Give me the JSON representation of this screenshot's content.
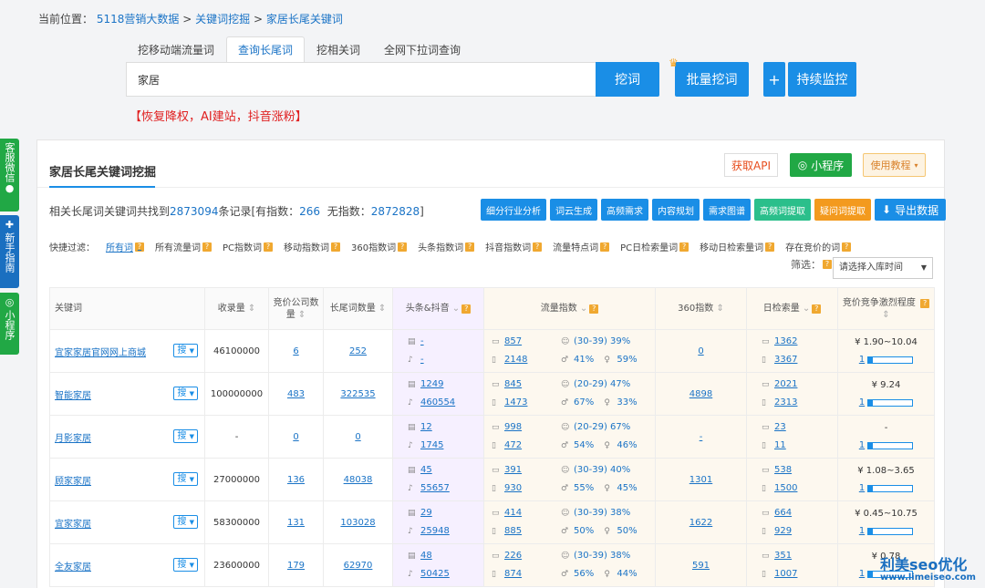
{
  "breadcrumb": {
    "prefix": "当前位置：",
    "items": [
      "5118营销大数据",
      "关键词挖掘",
      "家居长尾关键词"
    ],
    "sep": ">"
  },
  "tabs": [
    "挖移动端流量词",
    "查询长尾词",
    "挖相关词",
    "全网下拉词查询"
  ],
  "search": {
    "value": "家居"
  },
  "buttons": {
    "dig": "挖词",
    "batch": "批量挖词",
    "plus": "+",
    "monitor": "持续监控"
  },
  "promo": "【恢复降权，AI建站，抖音涨粉】",
  "sidebar": [
    {
      "label": "客服微信",
      "icon": "wechat-icon"
    },
    {
      "label": "新手指南",
      "icon": "guide-icon"
    },
    {
      "label": "小程序",
      "icon": "mini-program-icon"
    }
  ],
  "panel": {
    "title": "家居长尾关键词挖掘",
    "api": "获取API",
    "mini": "小程序",
    "tutorial": "使用教程"
  },
  "summary": {
    "prefix": "相关长尾词关键词共找到",
    "total": "2873094",
    "mid": "条记录[有指数：",
    "with_index": "266",
    "mid2": "  无指数：",
    "no_index": "2872828",
    "suffix": "]"
  },
  "tool_buttons": [
    "细分行业分析",
    "词云生成",
    "高频需求",
    "内容规划",
    "需求图谱",
    "高频词提取",
    "疑问词提取",
    "导出数据"
  ],
  "filters": {
    "prefix": "快捷过滤：",
    "items": [
      "所有词",
      "所有流量词",
      "PC指数词",
      "移动指数词",
      "360指数词",
      "头条指数词",
      "抖音指数词",
      "流量特点词",
      "PC日检索量词",
      "移动日检索量词",
      "存在竞价的词"
    ]
  },
  "filter_select": {
    "label": "筛选：",
    "placeholder": "请选择入库时间"
  },
  "table": {
    "headers": {
      "keyword": "关键词",
      "records": "收录量",
      "bid_companies": "竞价公司数量",
      "longtail": "长尾词数量",
      "toutiao": "头条&抖音",
      "flow": "流量指数",
      "idx360": "360指数",
      "daily": "日检索量",
      "competition": "竞价竞争激烈程度"
    },
    "search_btn": "搜",
    "rows": [
      {
        "kw_pre": "宜家",
        "kw_hl": "家居",
        "kw_post": "官网网上商城",
        "records": "46100000",
        "bid": "6",
        "longtail": "252",
        "tt1": "-",
        "tt2": "-",
        "pc": "857",
        "mobile": "2148",
        "age": "(30-39) 39%",
        "female": "41%",
        "male": "59%",
        "i360": "0",
        "d_pc": "1362",
        "d_mob": "3367",
        "price": "¥ 1.90~10.04",
        "level": "1",
        "fill": 0.1
      },
      {
        "kw_pre": "智能",
        "kw_hl": "家居",
        "kw_post": "",
        "records": "100000000",
        "bid": "483",
        "longtail": "322535",
        "tt1": "1249",
        "tt2": "460554",
        "pc": "845",
        "mobile": "1473",
        "age": "(20-29) 47%",
        "female": "67%",
        "male": "33%",
        "i360": "4898",
        "d_pc": "2021",
        "d_mob": "2313",
        "price": "¥ 9.24",
        "level": "1",
        "fill": 0.1
      },
      {
        "kw_pre": "月影",
        "kw_hl": "家居",
        "kw_post": "",
        "records": "-",
        "bid": "0",
        "longtail": "0",
        "tt1": "12",
        "tt2": "1745",
        "pc": "998",
        "mobile": "472",
        "age": "(20-29) 67%",
        "female": "54%",
        "male": "46%",
        "i360": "-",
        "d_pc": "23",
        "d_mob": "11",
        "price": "-",
        "level": "1",
        "fill": 0.1
      },
      {
        "kw_pre": "顾家",
        "kw_hl": "家居",
        "kw_post": "",
        "records": "27000000",
        "bid": "136",
        "longtail": "48038",
        "tt1": "45",
        "tt2": "55657",
        "pc": "391",
        "mobile": "930",
        "age": "(30-39) 40%",
        "female": "55%",
        "male": "45%",
        "i360": "1301",
        "d_pc": "538",
        "d_mob": "1500",
        "price": "¥ 1.08~3.65",
        "level": "1",
        "fill": 0.1
      },
      {
        "kw_pre": "宜家",
        "kw_hl": "家居",
        "kw_post": "",
        "records": "58300000",
        "bid": "131",
        "longtail": "103028",
        "tt1": "29",
        "tt2": "25948",
        "pc": "414",
        "mobile": "885",
        "age": "(30-39) 38%",
        "female": "50%",
        "male": "50%",
        "i360": "1622",
        "d_pc": "664",
        "d_mob": "929",
        "price": "¥ 0.45~10.75",
        "level": "1",
        "fill": 0.1
      },
      {
        "kw_pre": "全友",
        "kw_hl": "家居",
        "kw_post": "",
        "records": "23600000",
        "bid": "179",
        "longtail": "62970",
        "tt1": "48",
        "tt2": "50425",
        "pc": "226",
        "mobile": "874",
        "age": "(30-39) 38%",
        "female": "56%",
        "male": "44%",
        "i360": "591",
        "d_pc": "351",
        "d_mob": "1007",
        "price": "¥ 0.78",
        "level": "1",
        "fill": 0.1
      }
    ]
  },
  "watermark": {
    "line1": "利美seo优化",
    "line2": "www.limeiseo.com"
  },
  "colors": {
    "primary": "#1a8ee6",
    "green": "#21a845",
    "orange": "#f39a1e",
    "red": "#e02020"
  }
}
